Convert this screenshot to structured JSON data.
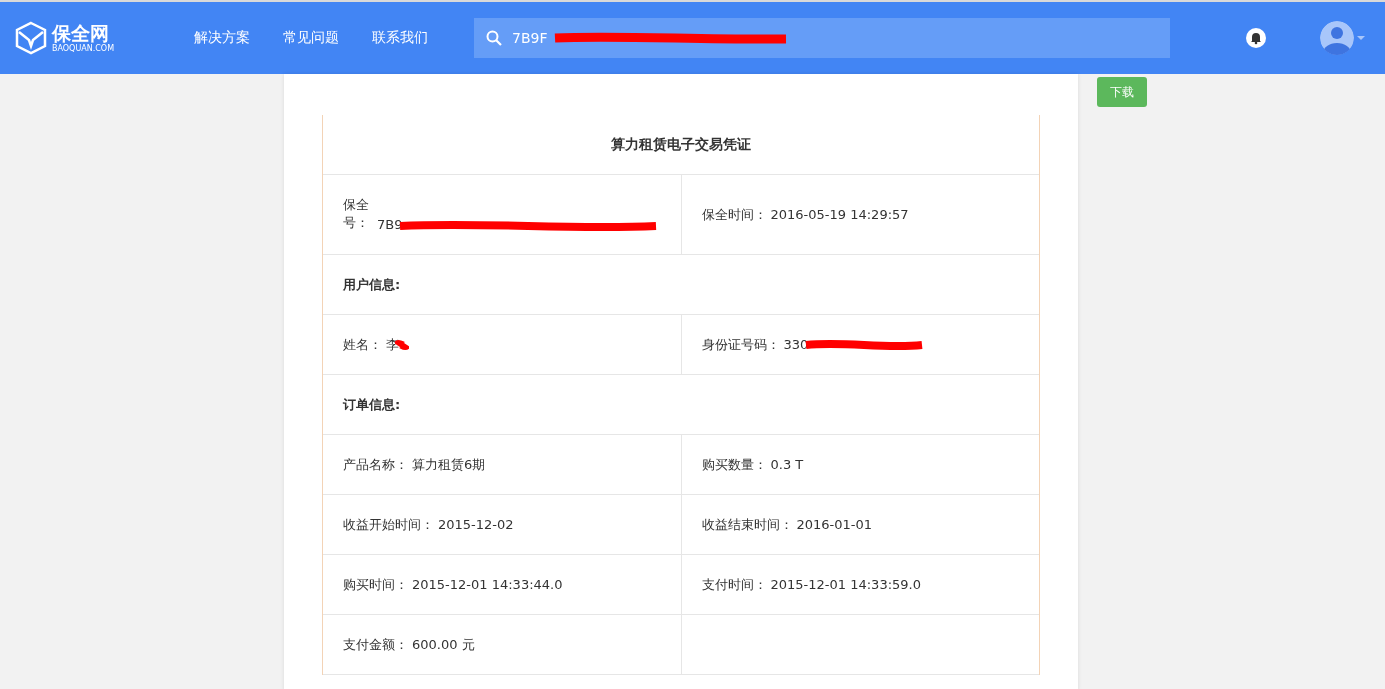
{
  "header": {
    "logo": {
      "name": "保全网",
      "domain": "BAOQUAN.COM"
    },
    "nav": [
      {
        "label": "解决方案"
      },
      {
        "label": "常见问题"
      },
      {
        "label": "联系我们"
      }
    ],
    "search": {
      "value": "7B9F"
    }
  },
  "download_button": "下载",
  "certificate": {
    "rows": [
      {
        "kind": "title",
        "text": "算力租赁电子交易凭证"
      },
      {
        "kind": "pair",
        "cells": [
          {
            "label": "保全号：",
            "value": "7B9",
            "redacted": true
          },
          {
            "label": "保全时间：",
            "value": "2016-05-19 14:29:57",
            "redacted": false
          }
        ]
      },
      {
        "kind": "section",
        "text": "用户信息:"
      },
      {
        "kind": "pair",
        "cells": [
          {
            "label": "姓名：",
            "value": "李",
            "redacted": true
          },
          {
            "label": "身份证号码：",
            "value": "330",
            "redacted": true
          }
        ]
      },
      {
        "kind": "section",
        "text": "订单信息:"
      },
      {
        "kind": "pair",
        "cells": [
          {
            "label": "产品名称：",
            "value": "算力租赁6期",
            "redacted": false
          },
          {
            "label": "购买数量：",
            "value": "0.3 T",
            "redacted": false
          }
        ]
      },
      {
        "kind": "pair",
        "cells": [
          {
            "label": "收益开始时间：",
            "value": "2015-12-02",
            "redacted": false
          },
          {
            "label": "收益结束时间：",
            "value": "2016-01-01",
            "redacted": false
          }
        ]
      },
      {
        "kind": "pair",
        "cells": [
          {
            "label": "购买时间：",
            "value": "2015-12-01 14:33:44.0",
            "redacted": false
          },
          {
            "label": "支付时间：",
            "value": "2015-12-01 14:33:59.0",
            "redacted": false
          }
        ]
      },
      {
        "kind": "pair",
        "cells": [
          {
            "label": "支付金额：",
            "value": "600.00 元",
            "redacted": false
          }
        ]
      }
    ]
  }
}
